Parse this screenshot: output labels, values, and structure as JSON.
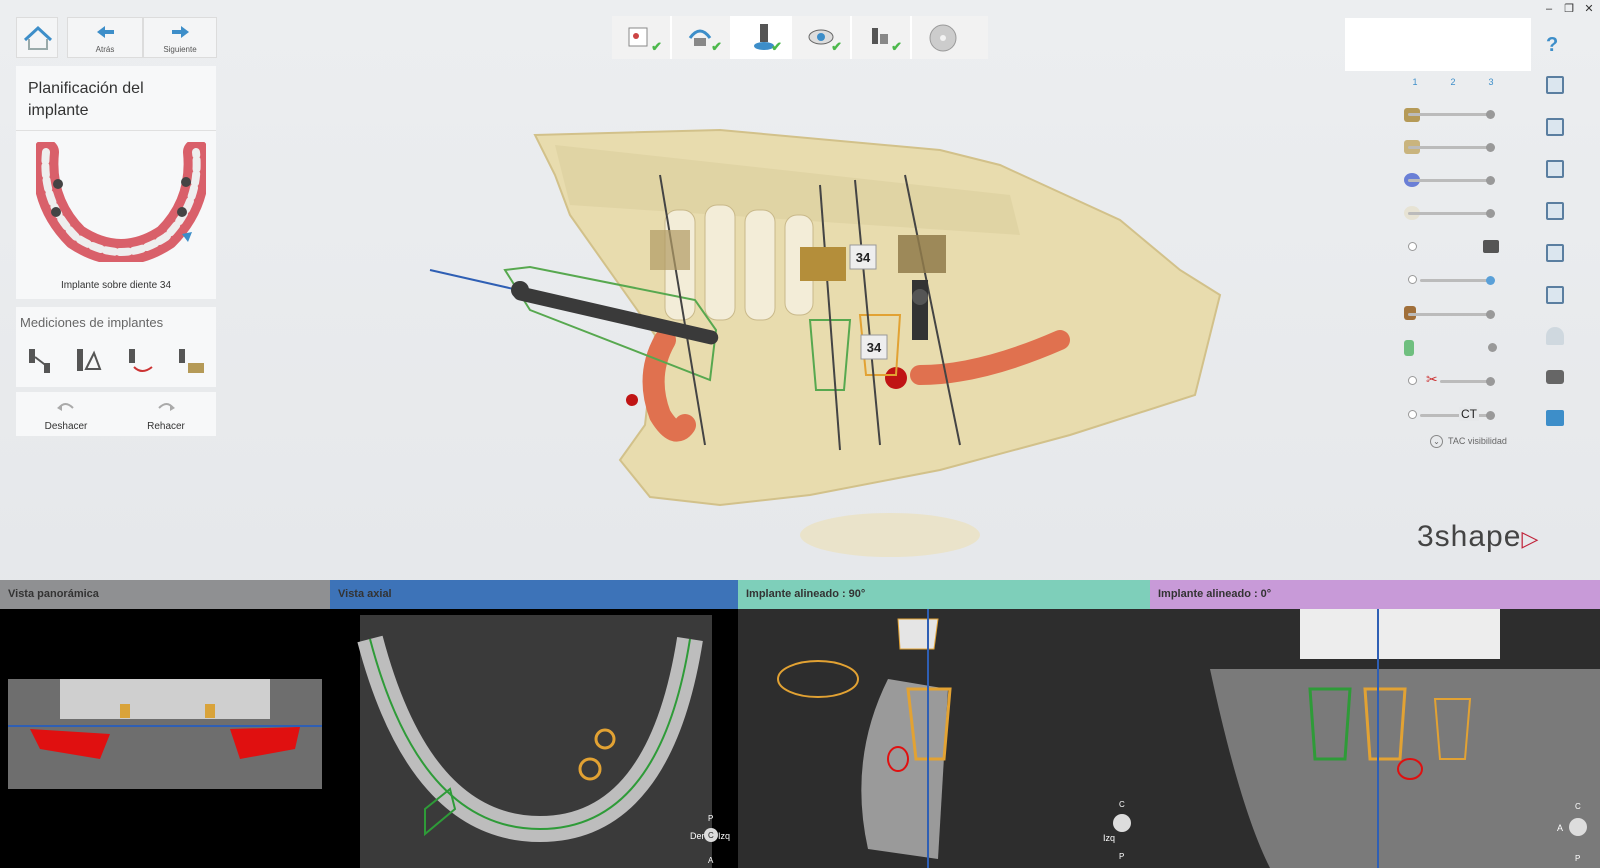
{
  "nav": {
    "back_label": "Atrás",
    "next_label": "Siguiente"
  },
  "planning": {
    "title": "Planificación del implante",
    "thumbnail_caption": "Implante sobre diente 34"
  },
  "measurements": {
    "title": "Mediciones de implantes",
    "undo_label": "Deshacer",
    "redo_label": "Rehacer"
  },
  "workflow_steps": [
    {
      "name": "prescription",
      "done": true
    },
    {
      "name": "scan-alignment",
      "done": true
    },
    {
      "name": "implant-placement",
      "done": true,
      "active": true
    },
    {
      "name": "review",
      "done": true
    },
    {
      "name": "guide-design",
      "done": true
    },
    {
      "name": "export",
      "done": false
    }
  ],
  "scene": {
    "tooth_label_upper": "34",
    "tooth_label_lower": "34"
  },
  "visibility": {
    "tabs": [
      "1",
      "2",
      "3"
    ],
    "ct_label": "CT",
    "tac_visibility_label": "TAC visibilidad",
    "help": "?"
  },
  "brand": {
    "logo": "3shape"
  },
  "views": [
    {
      "title": "Vista panorámica",
      "color": "#8f9092"
    },
    {
      "title": "Vista axial",
      "color": "#3d73b8"
    },
    {
      "title": "Implante alineado : 90°",
      "color": "#7ecfba"
    },
    {
      "title": "Implante alineado : 0°",
      "color": "#c89ad8"
    }
  ],
  "orientation": {
    "axial": [
      "Der",
      "Izq",
      "P",
      "A",
      "C"
    ],
    "view90": [
      "Izq",
      "C",
      "P"
    ],
    "view0": [
      "A",
      "C",
      "P"
    ]
  }
}
